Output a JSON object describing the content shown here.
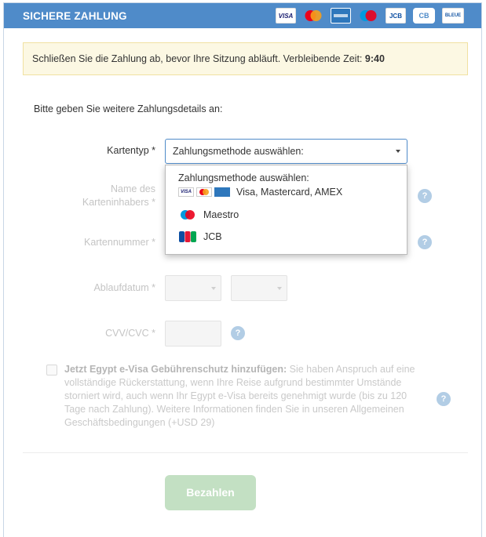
{
  "header": {
    "title": "SICHERE ZAHLUNG",
    "card_logos": [
      {
        "name": "visa",
        "text": "VISA"
      },
      {
        "name": "mastercard",
        "text": ""
      },
      {
        "name": "amex",
        "text": ""
      },
      {
        "name": "maestro",
        "text": ""
      },
      {
        "name": "jcb",
        "text": "JCB"
      },
      {
        "name": "cb",
        "text": "CB"
      },
      {
        "name": "carte-bleue",
        "text": "BLEUE"
      }
    ]
  },
  "alert": {
    "text": "Schließen Sie die Zahlung ab, bevor Ihre Sitzung abläuft. Verbleibende Zeit:",
    "time": "9:40"
  },
  "form": {
    "intro": "Bitte geben Sie weitere Zahlungsdetails an:",
    "card_type_label": "Kartentyp *",
    "card_type_value": "Zahlungsmethode auswählen:",
    "cardholder_label_1": "Name des",
    "cardholder_label_2": "Karteninhabers *",
    "card_number_label": "Kartennummer *",
    "expiry_label": "Ablaufdatum *",
    "cvv_label": "CVV/CVC *",
    "help_mark": "?"
  },
  "dropdown": {
    "header": "Zahlungsmethode auswählen:",
    "options": [
      {
        "label": "Visa, Mastercard, AMEX",
        "icons": [
          "visa",
          "mastercard",
          "amex"
        ]
      },
      {
        "label": "Maestro",
        "icons": [
          "maestro"
        ]
      },
      {
        "label": "JCB",
        "icons": [
          "jcb"
        ]
      }
    ]
  },
  "protection": {
    "title": "Jetzt Egypt e-Visa Gebührenschutz hinzufügen:",
    "text": "Sie haben Anspruch auf eine vollständige Rückerstattung, wenn Ihre Reise aufgrund bestimmter Umstände storniert wird, auch wenn Ihr Egypt e-Visa bereits genehmigt wurde (bis zu 120 Tage nach Zahlung). Weitere Informationen finden Sie in unseren Allgemeinen Geschäftsbedingungen (+USD 29)"
  },
  "pay_button": "Bezahlen",
  "colors": {
    "header_bg": "#4f8bc9",
    "alert_bg": "#fcf8e3",
    "pay_button_bg": "#c3e0c3",
    "help_icon": "#b2cde5"
  }
}
